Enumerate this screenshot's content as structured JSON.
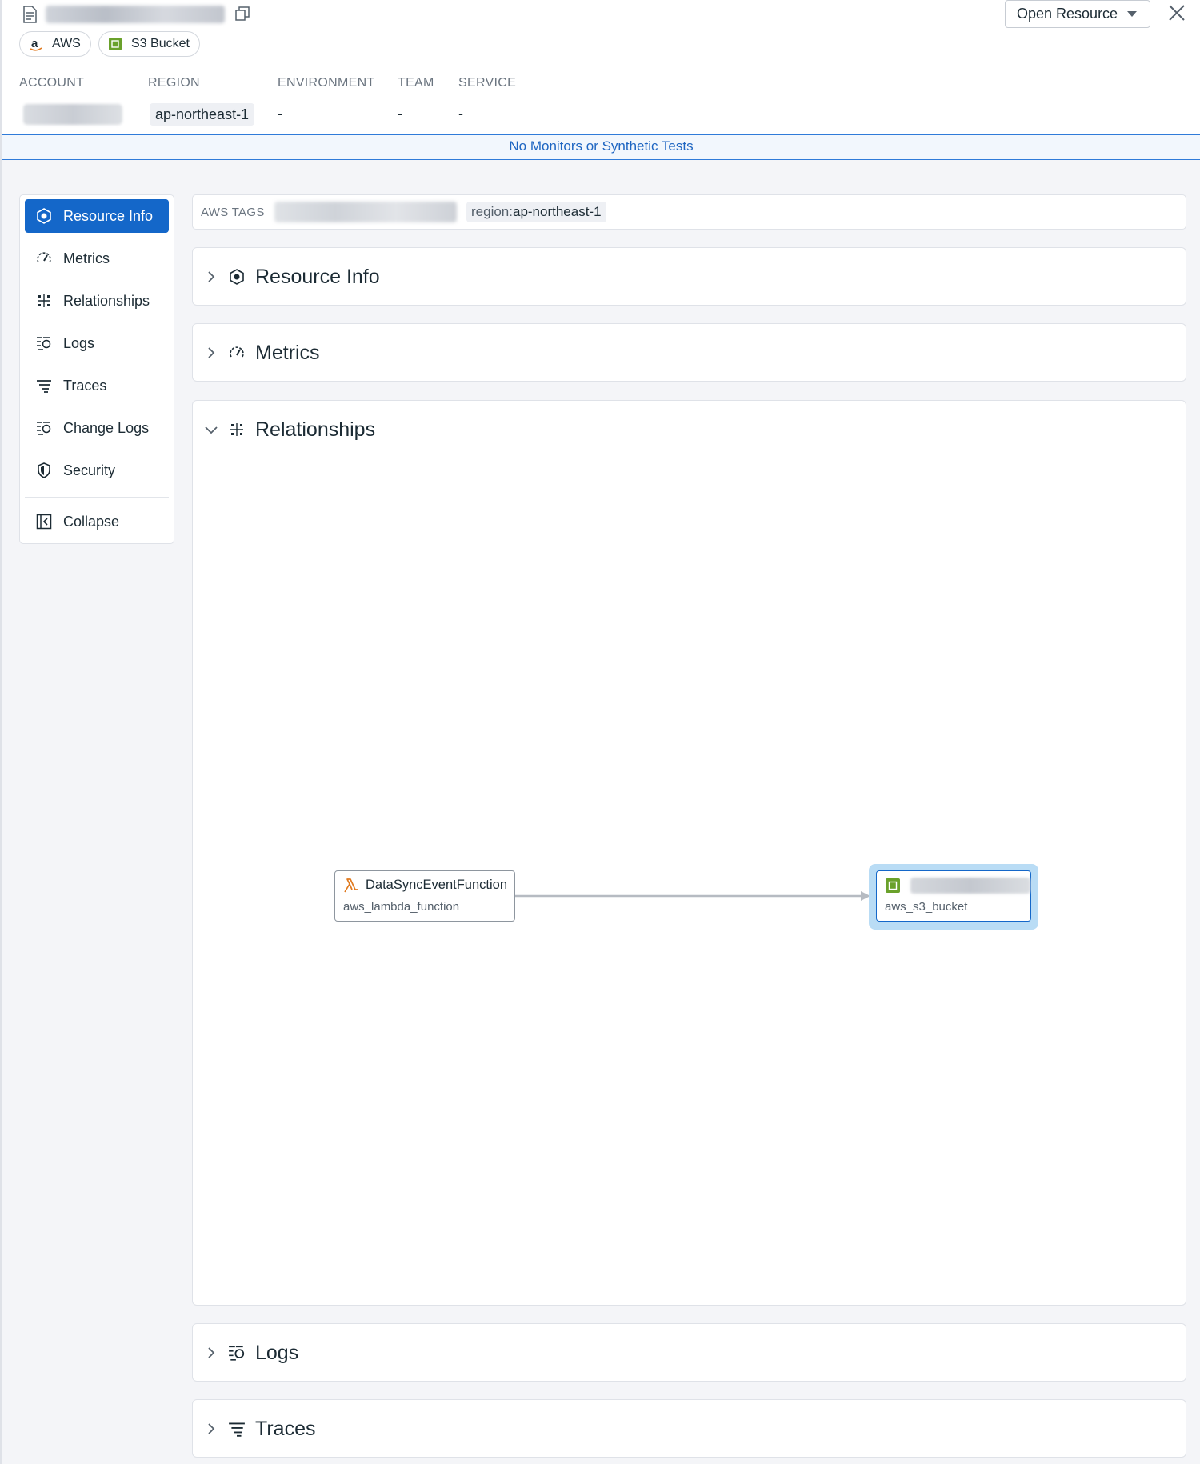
{
  "header": {
    "open_button_label": "Open Resource"
  },
  "chips": [
    {
      "label": "AWS",
      "icon": "amazon-icon"
    },
    {
      "label": "S3 Bucket",
      "icon": "s3-bucket-icon"
    }
  ],
  "meta": {
    "labels": {
      "account": "ACCOUNT",
      "region": "REGION",
      "environment": "ENVIRONMENT",
      "team": "TEAM",
      "service": "SERVICE"
    },
    "values": {
      "region": "ap-northeast-1",
      "environment": "-",
      "team": "-",
      "service": "-"
    }
  },
  "banner": {
    "text": "No Monitors or Synthetic Tests"
  },
  "sidebar": {
    "items": [
      {
        "label": "Resource Info",
        "icon": "resource-info-icon",
        "active": true
      },
      {
        "label": "Metrics",
        "icon": "metrics-gauge-icon"
      },
      {
        "label": "Relationships",
        "icon": "relationships-icon"
      },
      {
        "label": "Logs",
        "icon": "logs-icon"
      },
      {
        "label": "Traces",
        "icon": "traces-icon"
      },
      {
        "label": "Change Logs",
        "icon": "change-logs-icon"
      },
      {
        "label": "Security",
        "icon": "security-shield-icon"
      }
    ],
    "collapse_label": "Collapse"
  },
  "tags": {
    "label": "AWS TAGS",
    "region_key": "region:",
    "region_value": "ap-northeast-1"
  },
  "sections": [
    {
      "title": "Resource Info",
      "expanded": false
    },
    {
      "title": "Metrics",
      "expanded": false
    },
    {
      "title": "Relationships",
      "expanded": true
    },
    {
      "title": "Logs",
      "expanded": false
    },
    {
      "title": "Traces",
      "expanded": false
    }
  ],
  "graph": {
    "source": {
      "name": "DataSyncEventFunction",
      "type": "aws_lambda_function",
      "icon": "lambda-icon"
    },
    "target": {
      "type": "aws_s3_bucket",
      "icon": "s3-bucket-icon"
    },
    "colors": {
      "accent": "#1467c9",
      "lambda": "#e07a1f",
      "s3": "#6aa12b",
      "edge": "#b6bbc2"
    }
  }
}
